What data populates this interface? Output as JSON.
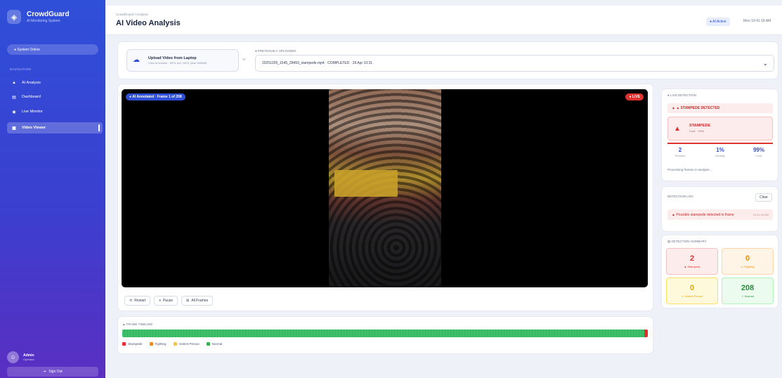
{
  "sidebar": {
    "brand_name": "CrowdGuard",
    "brand_sub": "AI Monitoring System",
    "system_status": "● System Online",
    "nav_heading": "NAVIGATION",
    "items": [
      {
        "icon": "▲",
        "label": "AI Analysis"
      },
      {
        "icon": "▤",
        "label": "Dashboard"
      },
      {
        "icon": "◉",
        "label": "Live Monitor"
      },
      {
        "icon": "▦",
        "label": "Video Viewer"
      }
    ],
    "user_name": "Admin",
    "user_role": "Operator",
    "signout_label": "Sign Out"
  },
  "topbar": {
    "breadcrumb": "CrowdGuard / Analysis",
    "title": "AI Video Analysis",
    "badge": "● AI Active",
    "time": "Mon 10:41:18 AM"
  },
  "upload": {
    "title": "Upload Video from Laptop",
    "sub": "Click to browse · MP4, AVI, MOV (max 500MB)",
    "or": "or"
  },
  "selector": {
    "label": "● PREVIOUSLY UPLOADED",
    "value": "20251205_1545_28493_stampede.mp4 · COMPLETED · 29 Apr 10:31"
  },
  "video": {
    "badge": "● AI Annotated · Frame 1 of 208",
    "live": "● LIVE"
  },
  "controls": [
    {
      "icon": "⟲",
      "label": "Restart"
    },
    {
      "icon": "⏸",
      "label": "Pause"
    },
    {
      "icon": "⊞",
      "label": "All Frames"
    }
  ],
  "timeline": {
    "label": "▲ FRAME TIMELINE",
    "legend": [
      {
        "label": "Stampede",
        "color": "#e03131"
      },
      {
        "label": "Fighting",
        "color": "#f08c00"
      },
      {
        "label": "Violent Person",
        "color": "#f5c542"
      },
      {
        "label": "Normal",
        "color": "#37b24d"
      }
    ],
    "risk_fraction": 0.99
  },
  "live_panel": {
    "heading": "● LIVE DETECTION",
    "alert_strip": "▲ ▲ STAMPEDE DETECTED",
    "alert_title": "STAMPEDE",
    "alert_sub": "Conf. · 99%",
    "risk_fraction": 1.0,
    "minis": [
      {
        "value": "2",
        "label": "Persons"
      },
      {
        "value": "1%",
        "label": "Density"
      },
      {
        "value": "99%",
        "label": "Conf"
      }
    ],
    "note": "Processing frames in analysis..."
  },
  "log_panel": {
    "heading": "DETECTION LOG",
    "clear_label": "Clear",
    "item": "▲ Possible stampede detected in frame",
    "item_time": "10:41:18 AM"
  },
  "summary_panel": {
    "heading": "▤ DETECTION SUMMARY",
    "stats": [
      {
        "value": "2",
        "label": "▲ Stampede",
        "bg": "#fdecec",
        "border": "#f5c2c2",
        "color": "#e03131"
      },
      {
        "value": "0",
        "label": "⚔ Fighting",
        "bg": "#fff4e6",
        "border": "#ffd8a8",
        "color": "#f08c00"
      },
      {
        "value": "0",
        "label": "⚠ Violent Person",
        "bg": "#fff9db",
        "border": "#ffe066",
        "color": "#e0a800"
      },
      {
        "value": "208",
        "label": "✓ Normal",
        "bg": "#ebfbee",
        "border": "#b2f2bb",
        "color": "#2b8a3e"
      }
    ]
  }
}
